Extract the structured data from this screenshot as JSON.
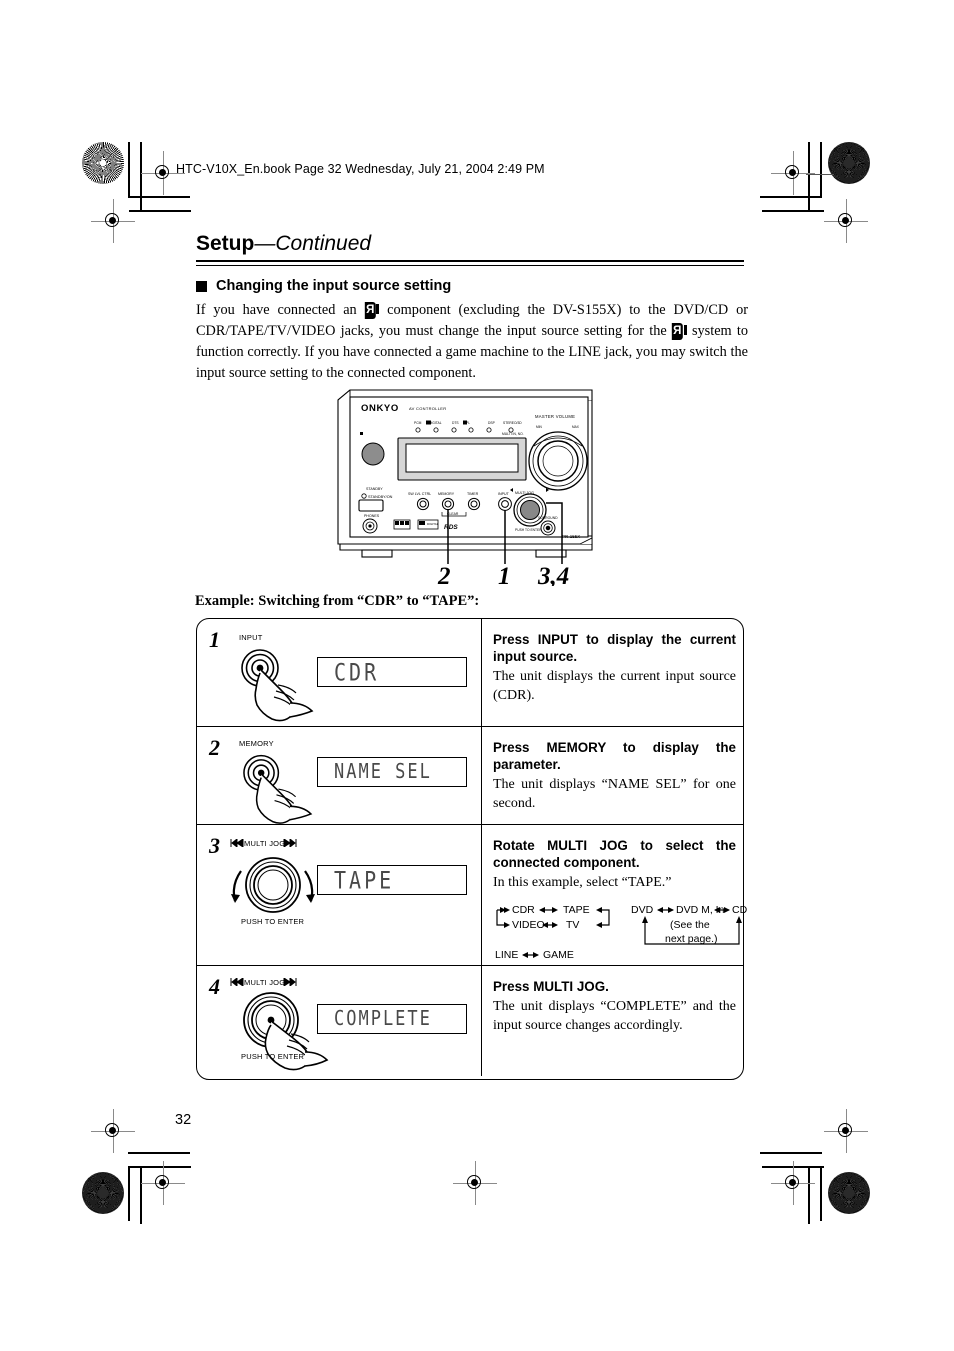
{
  "page": {
    "book_header": "HTC-V10X_En.book  Page 32  Wednesday, July 21, 2004  2:49 PM",
    "page_number": "32"
  },
  "title": {
    "main": "Setup",
    "continued": "—Continued"
  },
  "section": {
    "heading": "Changing the input source setting",
    "intro_part1": "If you have connected an ",
    "intro_part2": " component (excluding the DV-S155X) to the DVD/CD or CDR/TAPE/TV/VIDEO jacks, you must change the input source setting for the ",
    "intro_part3": " system to function correctly. If you have connected a game machine to the LINE jack, you may switch the input source setting to the connected component."
  },
  "receiver": {
    "brand": "ONKYO",
    "brand_sub": "AV CONTROLLER",
    "model": "PR-155X",
    "indicators": [
      "PCM",
      "DIGITAL",
      "DTS",
      "PLⅡ",
      "DSP",
      "STEREO/3D"
    ],
    "indicator_sub": "MULTI IN, NO.",
    "master_volume_label": "MASTER VOLUME",
    "volume_marks": "MIN   MAX",
    "standby_label": "STANDBY",
    "standby_on_label": "STANDBY/ON",
    "phones_label": "PHONES",
    "rds_label": "RDS",
    "surround_label": "SURROUND",
    "buttons": [
      {
        "label": "SW LVL CTRL"
      },
      {
        "label": "MEMORY"
      },
      {
        "label": "TIMER"
      },
      {
        "label": "INPUT"
      }
    ],
    "clear_label": "CLEAR",
    "multi_jog_label": "MULTI JOG",
    "push_to_enter_label": "PUSH TO ENTER",
    "callouts": [
      "2",
      "1",
      "3,4"
    ]
  },
  "example": {
    "caption": "Example: Switching from “CDR” to “TAPE”:"
  },
  "steps": [
    {
      "num": "1",
      "control_label": "INPUT",
      "display": "CDR",
      "heading": "Press INPUT to display the current input source.",
      "body": "The unit displays the current input source (CDR)."
    },
    {
      "num": "2",
      "control_label": "MEMORY",
      "display": "NAME SEL",
      "heading": "Press MEMORY to display the parameter.",
      "body": "The unit displays “NAME SEL” for one second."
    },
    {
      "num": "3",
      "control_label": "MULTI JOG",
      "control_sub_label": "PUSH TO ENTER",
      "display": "TAPE",
      "heading": "Rotate MULTI JOG to select the connected component.",
      "body": "In this example, select “TAPE.”"
    },
    {
      "num": "4",
      "control_label": "MULTI JOG",
      "control_sub_label": "PUSH TO ENTER",
      "display": "COMPLETE",
      "heading": "Press MULTI JOG.",
      "body": "The unit displays “COMPLETE” and the input source changes accordingly."
    }
  ],
  "cycle_diagram": {
    "group_a": {
      "row1": [
        "CDR",
        "TAPE"
      ],
      "row2": [
        "VIDEO",
        "TV"
      ]
    },
    "group_b": {
      "items": [
        "DVD",
        "DVD M, In",
        "CD"
      ],
      "note_line1": "(See the",
      "note_line2": "next page.)"
    },
    "group_c": {
      "items": [
        "LINE",
        "GAME"
      ]
    }
  }
}
